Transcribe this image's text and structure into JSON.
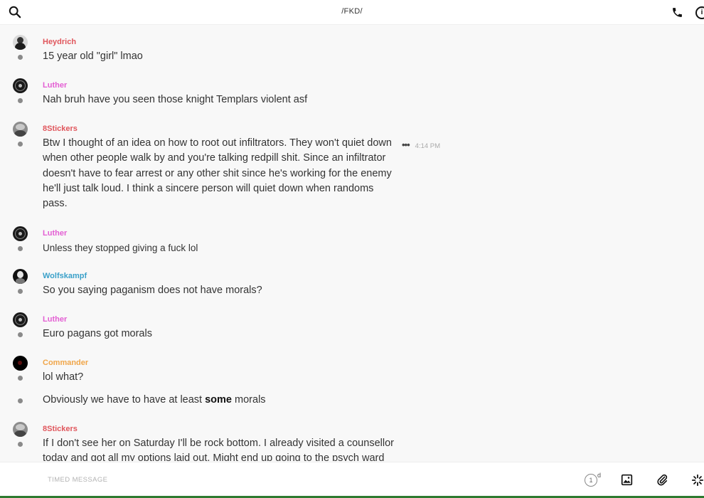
{
  "header": {
    "title": "/FKD/",
    "search_icon": "search-icon",
    "call_icon": "phone-icon",
    "info_icon": "info-icon"
  },
  "messages": [
    {
      "author": "Heydrich",
      "author_color": "#e0565c",
      "text": "15 year old \"girl\" lmao"
    },
    {
      "author": "Luther",
      "author_color": "#e35fd3",
      "text": "Nah bruh have you seen those knight Templars violent asf"
    },
    {
      "author": "8Stickers",
      "author_color": "#e0565c",
      "text": "Btw I thought of an idea on how to root out infiltrators. They won't quiet down when other people walk by and you're talking redpill shit. Since an infiltrator doesn't have to fear arrest or any other shit since he's working for the enemy he'll just talk loud. I think a sincere person will quiet down when randoms pass.",
      "time": "4:14 PM"
    },
    {
      "author": "Luther",
      "author_color": "#e35fd3",
      "text": "Unless they stopped giving a fuck lol"
    },
    {
      "author": "Wolfskampf",
      "author_color": "#3aa0c9",
      "text": "So you saying paganism does not have morals?"
    },
    {
      "author": "Luther",
      "author_color": "#e35fd3",
      "text": "Euro pagans got morals"
    },
    {
      "author": "Commander",
      "author_color": "#f0a64a",
      "text": "lol what?",
      "text2_pre": "Obviously we have to have at least ",
      "text2_bold": "some",
      "text2_post": " morals"
    },
    {
      "author": "8Stickers",
      "author_color": "#e0565c",
      "text": "If I don't see her on Saturday I'll be rock bottom. I already visited a counsellor today and got all my options laid out. Might end up going to the psych ward in"
    }
  ],
  "composer": {
    "placeholder": "TIMED MESSAGE",
    "timer_value": "1",
    "timer_unit": "d",
    "image_icon": "image-icon",
    "attach_icon": "paperclip-icon",
    "sticker_icon": "sparkle-icon"
  }
}
